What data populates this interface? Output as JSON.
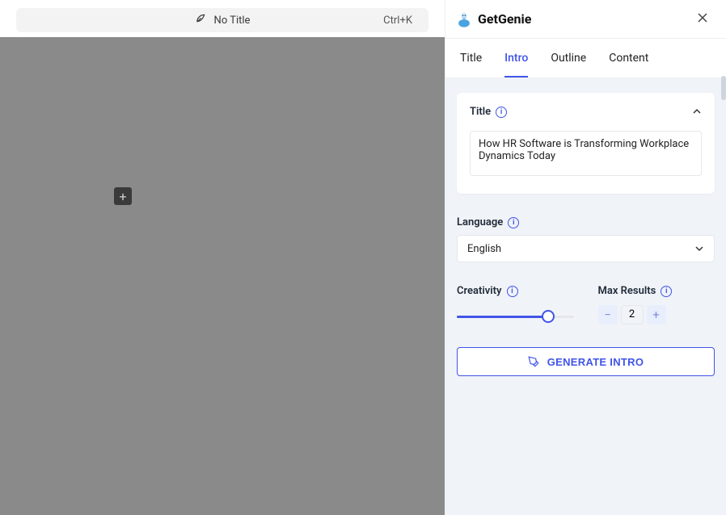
{
  "topbar": {
    "title": "No Title",
    "shortcut": "Ctrl+K"
  },
  "brand": "GetGenie",
  "tabs": [
    "Title",
    "Intro",
    "Outline",
    "Content"
  ],
  "activeTab": "Intro",
  "titleCard": {
    "label": "Title",
    "value": "How HR Software is Transforming Workplace Dynamics Today"
  },
  "language": {
    "label": "Language",
    "value": "English"
  },
  "creativity": {
    "label": "Creativity",
    "percent": 78
  },
  "maxResults": {
    "label": "Max Results",
    "value": "2"
  },
  "generateLabel": "GENERATE INTRO"
}
